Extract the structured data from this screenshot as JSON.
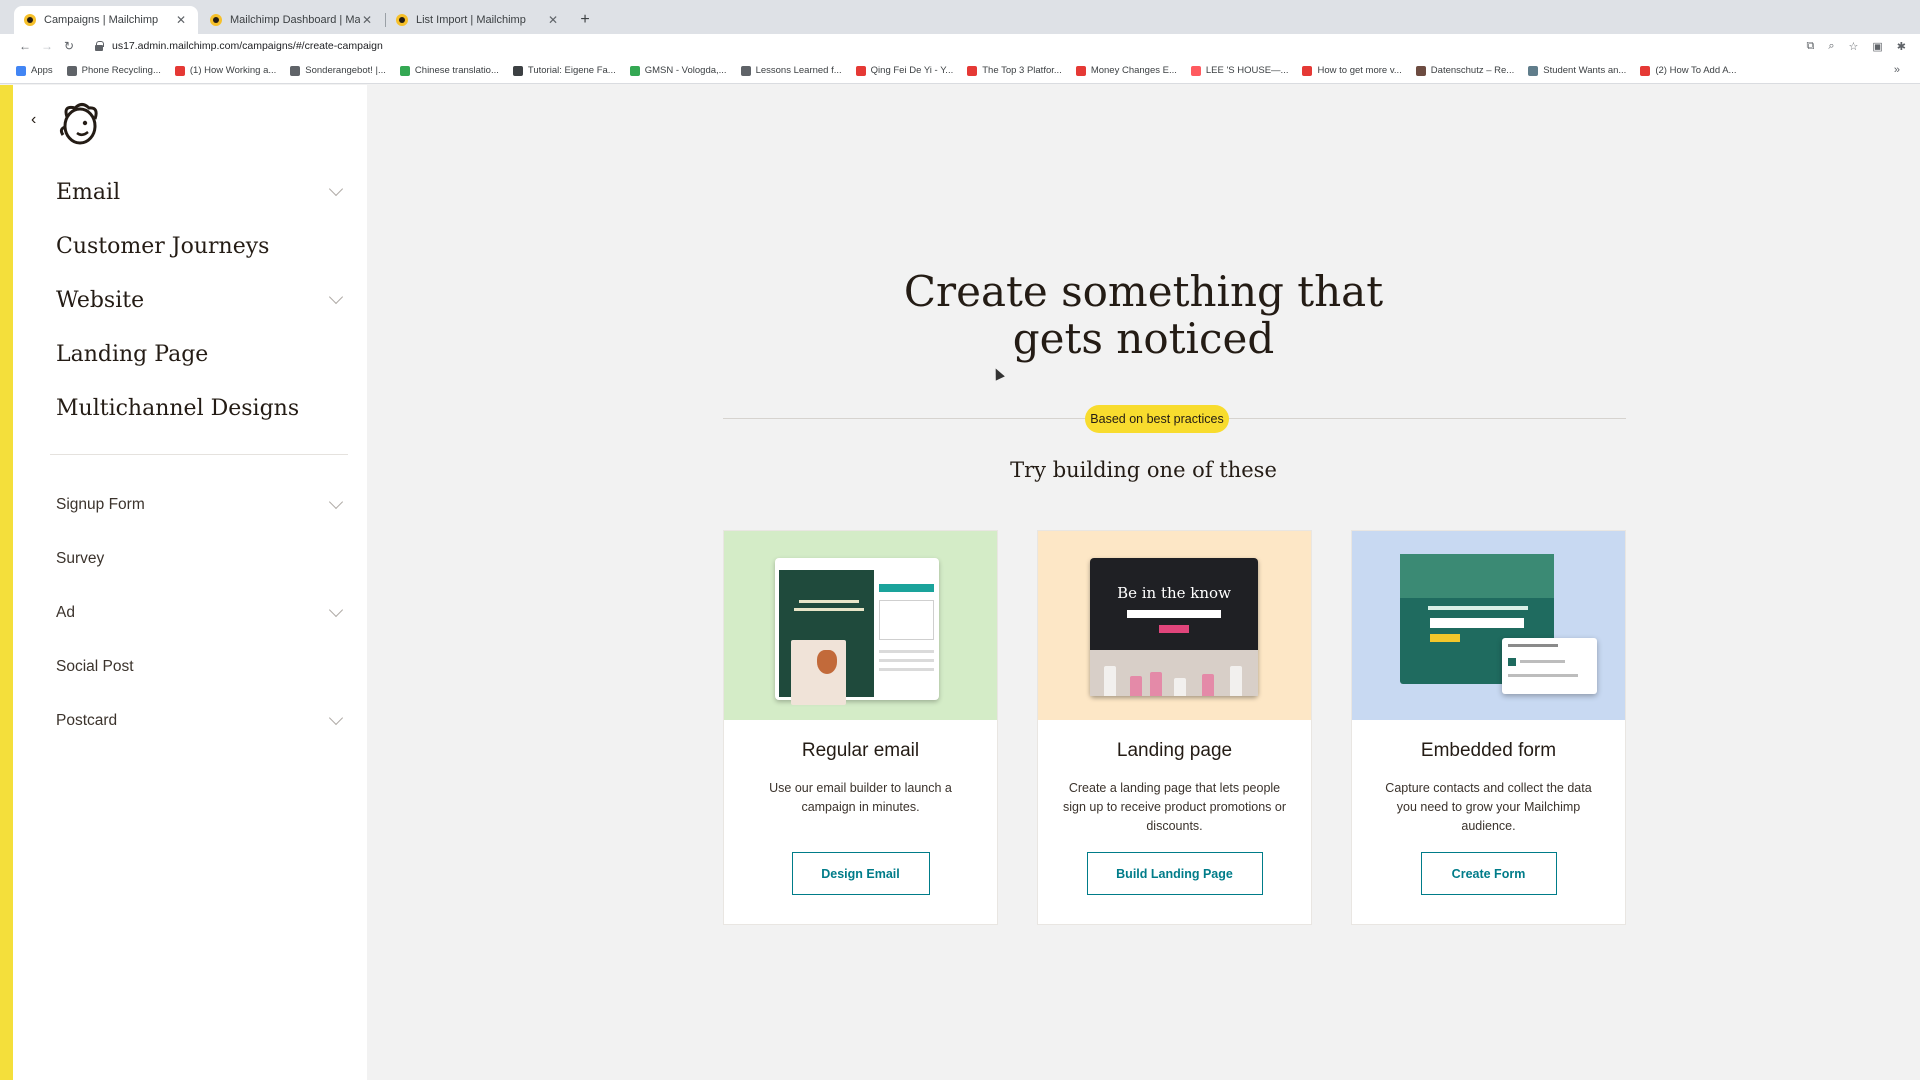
{
  "browser": {
    "tabs": [
      {
        "label": "Campaigns | Mailchimp",
        "active": true
      },
      {
        "label": "Mailchimp Dashboard | Mailchimp",
        "active": false
      },
      {
        "label": "List Import | Mailchimp",
        "active": false
      }
    ],
    "url": "us17.admin.mailchimp.com/campaigns/#/create-campaign",
    "bookmarks": [
      {
        "label": "Apps",
        "color": "#4285f4"
      },
      {
        "label": "Phone Recycling...",
        "color": "#5f6368"
      },
      {
        "label": "(1) How Working a...",
        "color": "#e53935"
      },
      {
        "label": "Sonderangebot! |...",
        "color": "#5f6368"
      },
      {
        "label": "Chinese translatio...",
        "color": "#34a853"
      },
      {
        "label": "Tutorial: Eigene Fa...",
        "color": "#3c4043"
      },
      {
        "label": "GMSN - Vologda,...",
        "color": "#34a853"
      },
      {
        "label": "Lessons Learned f...",
        "color": "#5f6368"
      },
      {
        "label": "Qing Fei De Yi - Y...",
        "color": "#e53935"
      },
      {
        "label": "The Top 3 Platfor...",
        "color": "#e53935"
      },
      {
        "label": "Money Changes E...",
        "color": "#e53935"
      },
      {
        "label": "LEE 'S HOUSE—...",
        "color": "#ff5a5f"
      },
      {
        "label": "How to get more v...",
        "color": "#e53935"
      },
      {
        "label": "Datenschutz – Re...",
        "color": "#6d4c41"
      },
      {
        "label": "Student Wants an...",
        "color": "#607d8b"
      },
      {
        "label": "(2) How To Add A...",
        "color": "#e53935"
      }
    ]
  },
  "sidebar": {
    "main_items": [
      {
        "label": "Email",
        "has_chevron": true
      },
      {
        "label": "Customer Journeys",
        "has_chevron": false
      },
      {
        "label": "Website",
        "has_chevron": true
      },
      {
        "label": "Landing Page",
        "has_chevron": false
      },
      {
        "label": "Multichannel Designs",
        "has_chevron": false
      }
    ],
    "sub_items": [
      {
        "label": "Signup Form",
        "has_chevron": true
      },
      {
        "label": "Survey",
        "has_chevron": false
      },
      {
        "label": "Ad",
        "has_chevron": true
      },
      {
        "label": "Social Post",
        "has_chevron": false
      },
      {
        "label": "Postcard",
        "has_chevron": true
      }
    ],
    "accent_color": "#f4df3b"
  },
  "main": {
    "headline_line1": "Create something that",
    "headline_line2": "gets noticed",
    "badge": "Based on best practices",
    "subheading": "Try building one of these",
    "cards": [
      {
        "title": "Regular email",
        "description": "Use our email builder to launch a campaign in minutes.",
        "button": "Design Email",
        "art_color": "#d4ecc7",
        "art_text": ""
      },
      {
        "title": "Landing page",
        "description": "Create a landing page that lets people sign up to receive product promotions or discounts.",
        "button": "Build Landing Page",
        "art_color": "#fde7c6",
        "art_text": "Be in the know"
      },
      {
        "title": "Embedded form",
        "description": "Capture contacts and collect the data you need to grow your Mailchimp audience.",
        "button": "Create Form",
        "art_color": "#c8d9f2",
        "art_text": ""
      }
    ]
  }
}
